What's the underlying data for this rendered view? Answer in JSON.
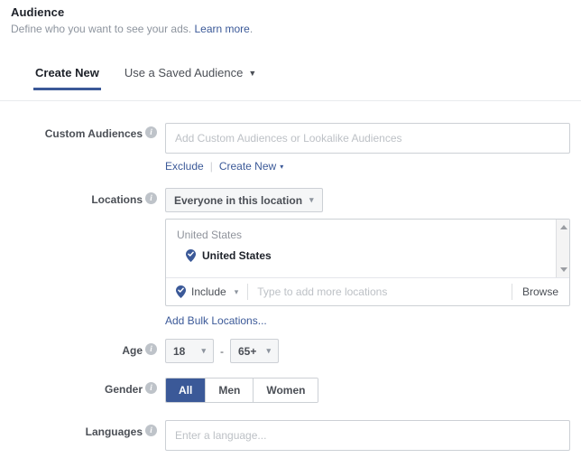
{
  "header": {
    "title": "Audience",
    "subtitle": "Define who you want to see your ads.",
    "learn_more": "Learn more",
    "period": "."
  },
  "tabs": [
    {
      "label": "Create New",
      "active": true
    },
    {
      "label": "Use a Saved Audience",
      "active": false,
      "caret": "▼"
    }
  ],
  "custom_audiences": {
    "label": "Custom Audiences",
    "placeholder": "Add Custom Audiences or Lookalike Audiences",
    "value": "",
    "exclude_link": "Exclude",
    "create_new_link": "Create New",
    "caret": "▾"
  },
  "locations": {
    "label": "Locations",
    "scope_button": "Everyone in this location",
    "caret": "▾",
    "group_header": "United States",
    "selected": [
      {
        "name": "United States",
        "icon": "map-pin-check-icon"
      }
    ],
    "include_label": "Include",
    "type_placeholder": "Type to add more locations",
    "type_value": "",
    "browse_label": "Browse",
    "bulk_link": "Add Bulk Locations...",
    "scrollbar": {
      "up": "▲",
      "down": "▼"
    }
  },
  "age": {
    "label": "Age",
    "min": "18",
    "max": "65+",
    "separator": "-",
    "caret": "▾"
  },
  "gender": {
    "label": "Gender",
    "options": [
      {
        "label": "All",
        "selected": true
      },
      {
        "label": "Men",
        "selected": false
      },
      {
        "label": "Women",
        "selected": false
      }
    ]
  },
  "languages": {
    "label": "Languages",
    "placeholder": "Enter a language...",
    "value": ""
  },
  "info_glyph": "i",
  "colors": {
    "accent_blue": "#3b5998",
    "link_blue": "#3b5998",
    "text_dark": "#1d2129",
    "text_muted": "#8d949e",
    "border": "#ccd0d5",
    "panel_gray": "#f5f6f7"
  }
}
